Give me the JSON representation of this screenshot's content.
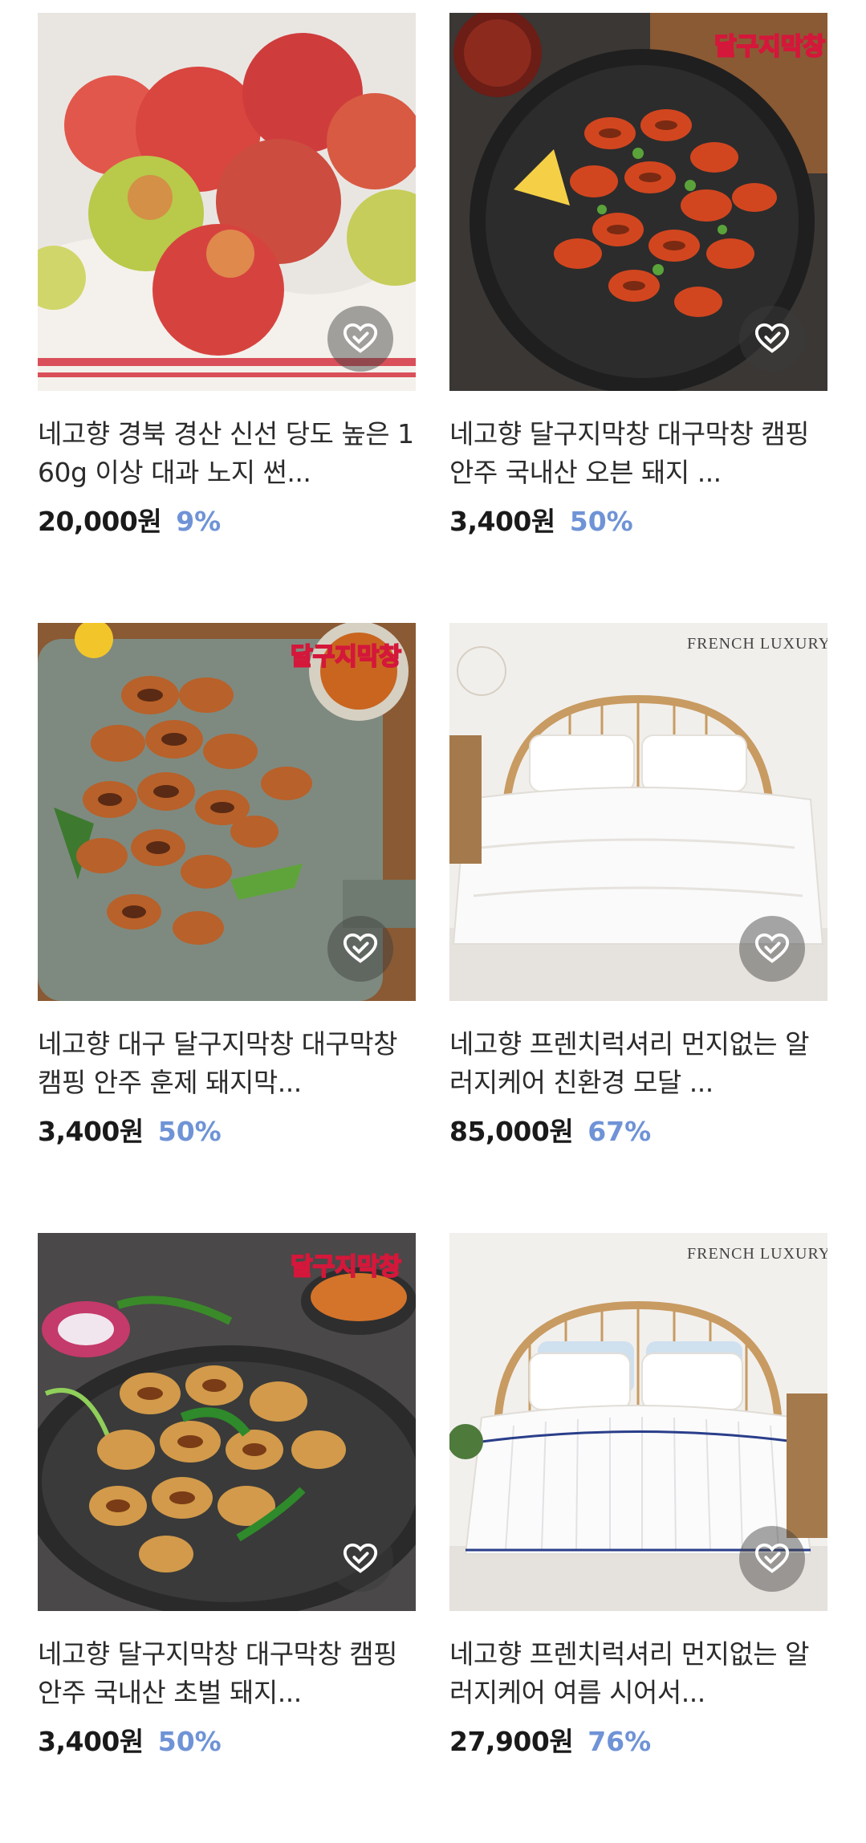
{
  "products": [
    {
      "title": "네고향 경북 경산 신선 당도 높은 160g 이상 대과 노지 썬...",
      "price": "20,000원",
      "discount": "9%",
      "image": "nectarines",
      "like_icon": "heart-check-icon"
    },
    {
      "title": "네고향 달구지막창 대구막창 캠핑 안주 국내산 오븐 돼지 ...",
      "price": "3,400원",
      "discount": "50%",
      "image": "grilled-makchang-pan",
      "stamp": "달구지막창",
      "like_icon": "heart-check-icon"
    },
    {
      "title": "네고향 대구 달구지막창 대구막창 캠핑 안주 훈제 돼지막...",
      "price": "3,400원",
      "discount": "50%",
      "image": "smoked-makchang-board",
      "stamp": "달구지막창",
      "like_icon": "heart-check-icon"
    },
    {
      "title": "네고향 프렌치럭셔리 먼지없는 알러지케어 친환경 모달 ...",
      "price": "85,000원",
      "discount": "67%",
      "image": "white-bedding",
      "brand_text": "FRENCH LUXURY",
      "like_icon": "heart-check-icon"
    },
    {
      "title": "네고향 달구지막창 대구막창 캠핑 안주 국내산 초벌 돼지...",
      "price": "3,400원",
      "discount": "50%",
      "image": "seared-makchang-plate",
      "stamp": "달구지막창",
      "like_icon": "heart-check-icon"
    },
    {
      "title": "네고향 프렌치럭셔리 먼지없는 알러지케어 여름 시어서...",
      "price": "27,900원",
      "discount": "76%",
      "image": "striped-bedding",
      "brand_text": "FRENCH LUXURY",
      "like_icon": "heart-check-icon"
    }
  ],
  "colors": {
    "discount": "#6f93d6",
    "price": "#1a1a1a",
    "title": "#2b2b2b"
  }
}
